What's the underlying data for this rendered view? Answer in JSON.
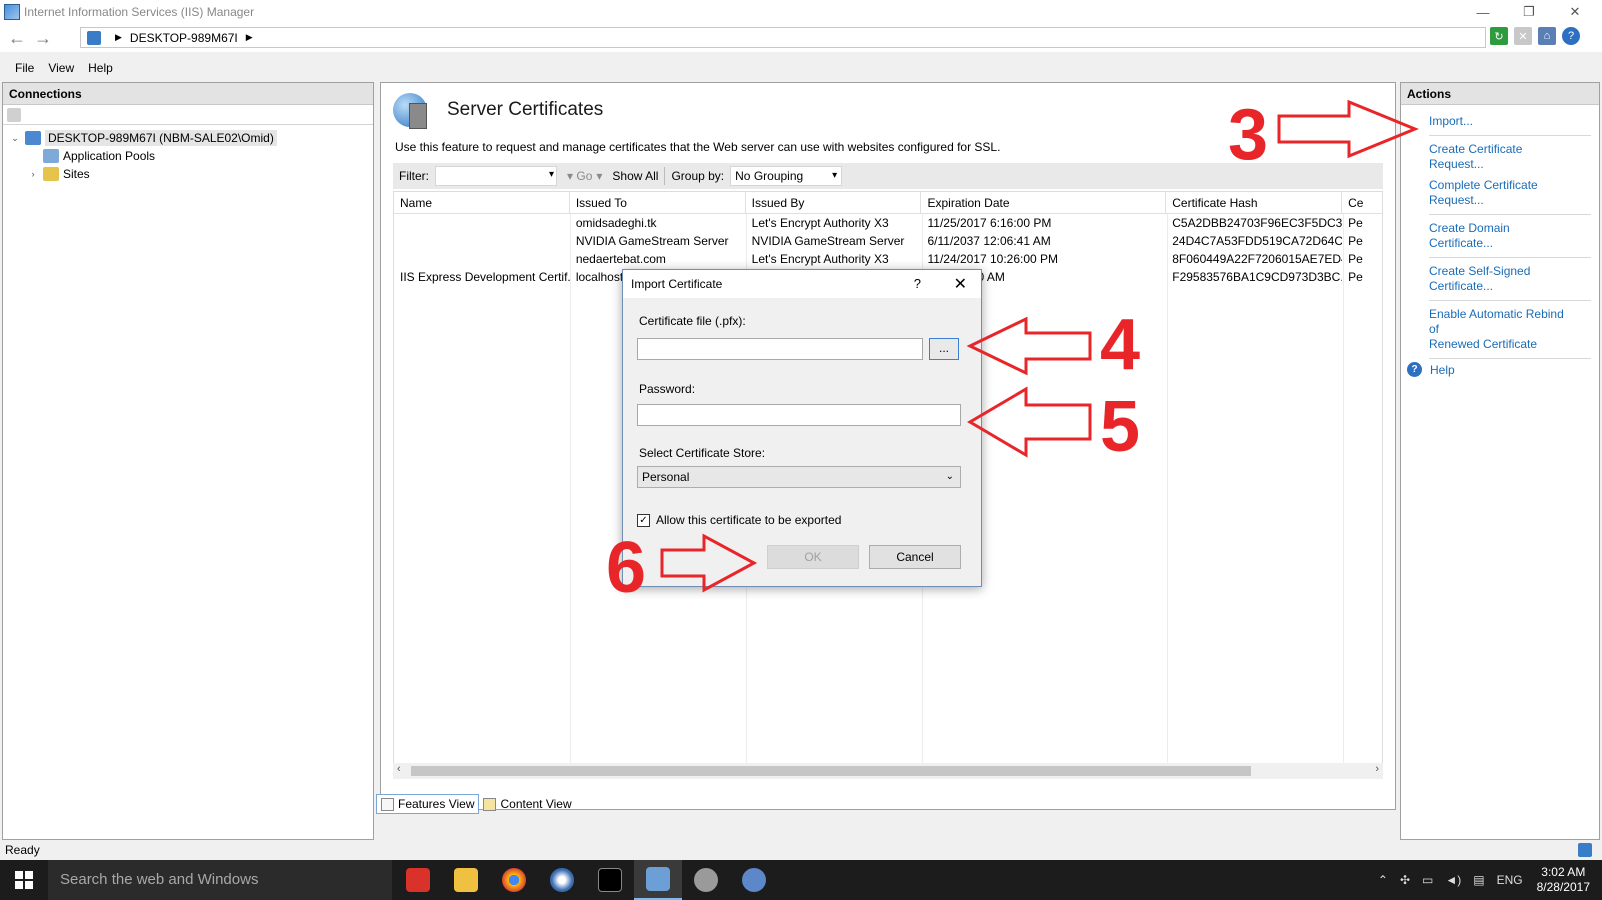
{
  "window": {
    "title": "Internet Information Services (IIS) Manager",
    "address_node": "DESKTOP-989M67I"
  },
  "menu": [
    "File",
    "View",
    "Help"
  ],
  "connections": {
    "header": "Connections",
    "tree": [
      {
        "label": "DESKTOP-989M67I (NBM-SALE02\\Omid)",
        "level": 0,
        "expanded": true
      },
      {
        "label": "Application Pools",
        "level": 1
      },
      {
        "label": "Sites",
        "level": 1,
        "collapsed": true
      }
    ]
  },
  "feature": {
    "title": "Server Certificates",
    "description": "Use this feature to request and manage certificates that the Web server can use with websites configured for SSL.",
    "filter_label": "Filter:",
    "filter_value": "",
    "go_label": "Go",
    "show_all_label": "Show All",
    "group_by_label": "Group by:",
    "group_by_value": "No Grouping",
    "columns": [
      "Name",
      "Issued To",
      "Issued By",
      "Expiration Date",
      "Certificate Hash",
      "Ce"
    ],
    "rows": [
      [
        "",
        "omidsadeghi.tk",
        "Let's Encrypt Authority X3",
        "11/25/2017 6:16:00 PM",
        "C5A2DBB24703F96EC3F5DC3...",
        "Pe"
      ],
      [
        "",
        "NVIDIA GameStream Server",
        "NVIDIA GameStream Server",
        "6/11/2037 12:06:41 AM",
        "24D4C7A53FDD519CA72D64C...",
        "Pe"
      ],
      [
        "",
        "nedaertebat.com",
        "Let's Encrypt Authority X3",
        "11/24/2017 10:26:00 PM",
        "8F060449A22F7206015AE7ED4...",
        "Pe"
      ],
      [
        "IIS Express Development Certif...",
        "localhost",
        "",
        "22 4:30:00 AM",
        "F29583576BA1C9CD973D3BC...",
        "Pe"
      ]
    ]
  },
  "view_tabs": {
    "features": "Features View",
    "content": "Content View"
  },
  "actions": {
    "header": "Actions",
    "import": "Import...",
    "create_request": "Create Certificate Request...",
    "complete_request": "Complete Certificate Request...",
    "create_domain": "Create Domain Certificate...",
    "create_self_signed": "Create Self-Signed Certificate...",
    "enable_rebind_1": "Enable Automatic Rebind of",
    "enable_rebind_2": "Renewed Certificate",
    "help": "Help"
  },
  "status": "Ready",
  "dialog": {
    "title": "Import Certificate",
    "help_glyph": "?",
    "file_label": "Certificate file (.pfx):",
    "file_value": "",
    "browse_label": "...",
    "password_label": "Password:",
    "password_value": "",
    "store_label": "Select Certificate Store:",
    "store_value": "Personal",
    "export_label": "Allow this certificate to be exported",
    "export_checked": true,
    "ok_label": "OK",
    "cancel_label": "Cancel"
  },
  "annotations": {
    "n3": "3",
    "n4": "4",
    "n5": "5",
    "n6": "6",
    "color": "#e8262a"
  },
  "taskbar": {
    "search_placeholder": "Search the web and Windows",
    "language": "ENG",
    "time": "3:02 AM",
    "date": "8/28/2017"
  }
}
